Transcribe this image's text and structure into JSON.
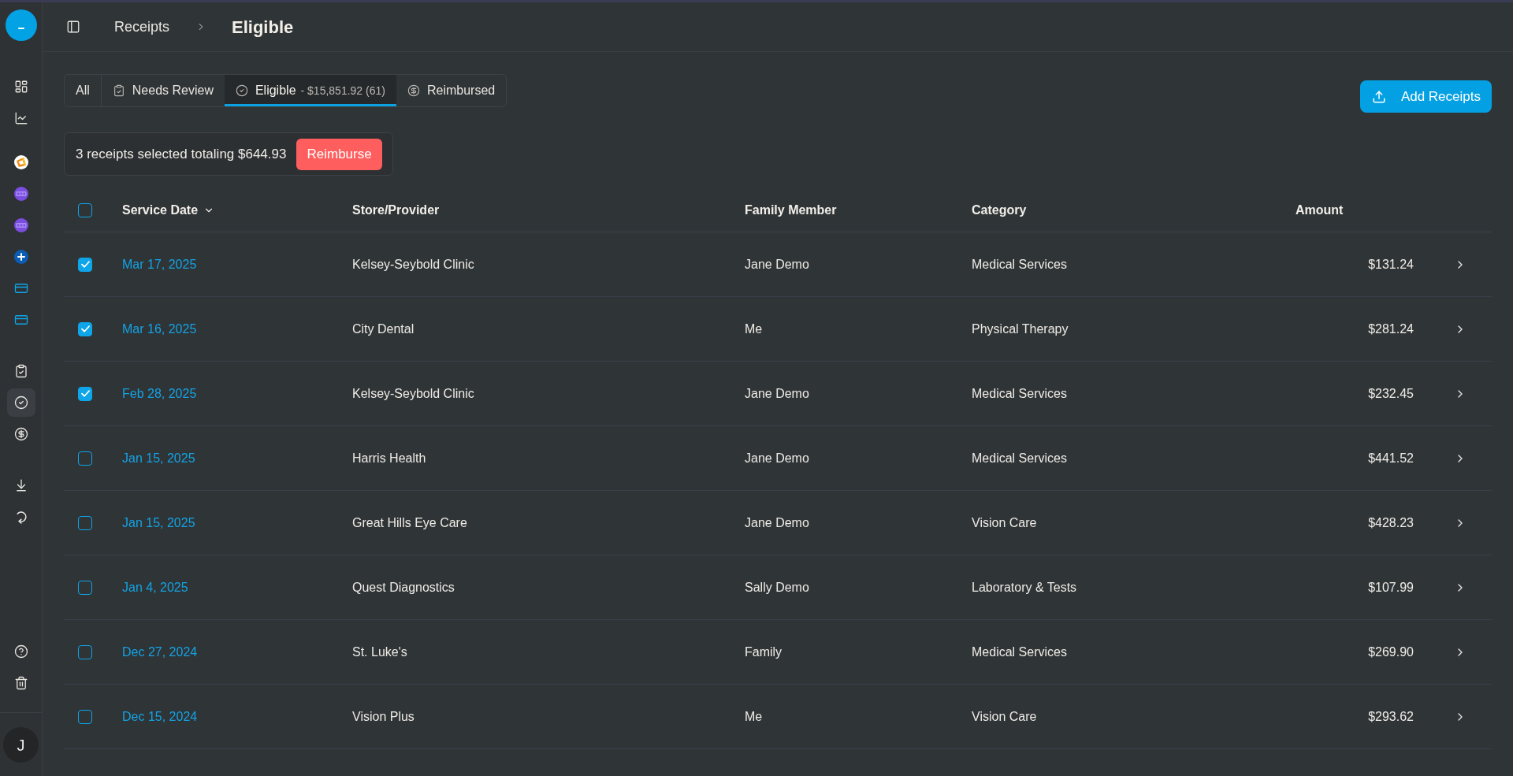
{
  "sidebar": {
    "groups": [
      {
        "items": [
          {
            "kind": "dashboard",
            "selected": false
          },
          {
            "kind": "chart",
            "selected": false
          }
        ]
      },
      {
        "items": [
          {
            "kind": "diamond-logo",
            "selected": false
          },
          {
            "kind": "band-logo",
            "selected": false
          },
          {
            "kind": "band-logo",
            "selected": false
          },
          {
            "kind": "plus-logo",
            "selected": false
          },
          {
            "kind": "card",
            "selected": false
          },
          {
            "kind": "card",
            "selected": false
          }
        ]
      },
      {
        "items": [
          {
            "kind": "clipboard",
            "selected": false
          },
          {
            "kind": "check-circle",
            "selected": true
          },
          {
            "kind": "dollar",
            "selected": false
          }
        ]
      },
      {
        "items": [
          {
            "kind": "download",
            "selected": false
          },
          {
            "kind": "refresh",
            "selected": false
          }
        ]
      }
    ],
    "footer": [
      {
        "kind": "help"
      },
      {
        "kind": "trash"
      }
    ],
    "avatar": "J"
  },
  "header": {
    "breadcrumbs": [
      {
        "label": "Receipts",
        "current": false
      },
      {
        "label": "Eligible",
        "current": true
      }
    ]
  },
  "tabs": [
    {
      "kind": "plain",
      "label": "All",
      "selected": false
    },
    {
      "kind": "clipboard",
      "label": "Needs Review",
      "selected": false
    },
    {
      "kind": "check",
      "label": "Eligible",
      "detail": "- $15,851.92 (61)",
      "selected": true
    },
    {
      "kind": "dollar",
      "label": "Reimbursed",
      "selected": false
    }
  ],
  "add_button": {
    "label": "Add Receipts"
  },
  "selection_bar": {
    "summary": "3 receipts selected totaling $644.93",
    "action": "Reimburse"
  },
  "table": {
    "select_all": false,
    "columns": [
      {
        "label": "Service Date",
        "sorted": true
      },
      {
        "label": "Store/Provider",
        "sorted": false
      },
      {
        "label": "Family Member",
        "sorted": false
      },
      {
        "label": "Category",
        "sorted": false
      },
      {
        "label": "Amount",
        "sorted": false
      }
    ],
    "rows": [
      {
        "checked": true,
        "date": "Mar 17, 2025",
        "provider": "Kelsey-Seybold Clinic",
        "member": "Jane Demo",
        "category": "Medical Services",
        "amount": "$131.24"
      },
      {
        "checked": true,
        "date": "Mar 16, 2025",
        "provider": "City Dental",
        "member": "Me",
        "category": "Physical Therapy",
        "amount": "$281.24"
      },
      {
        "checked": true,
        "date": "Feb 28, 2025",
        "provider": "Kelsey-Seybold Clinic",
        "member": "Jane Demo",
        "category": "Medical Services",
        "amount": "$232.45"
      },
      {
        "checked": false,
        "date": "Jan 15, 2025",
        "provider": "Harris Health",
        "member": "Jane Demo",
        "category": "Medical Services",
        "amount": "$441.52"
      },
      {
        "checked": false,
        "date": "Jan 15, 2025",
        "provider": "Great Hills Eye Care",
        "member": "Jane Demo",
        "category": "Vision Care",
        "amount": "$428.23"
      },
      {
        "checked": false,
        "date": "Jan 4, 2025",
        "provider": "Quest Diagnostics",
        "member": "Sally Demo",
        "category": "Laboratory & Tests",
        "amount": "$107.99"
      },
      {
        "checked": false,
        "date": "Dec 27, 2024",
        "provider": "St. Luke's",
        "member": "Family",
        "category": "Medical Services",
        "amount": "$269.90"
      },
      {
        "checked": false,
        "date": "Dec 15, 2024",
        "provider": "Vision Plus",
        "member": "Me",
        "category": "Vision Care",
        "amount": "$293.62"
      }
    ]
  }
}
